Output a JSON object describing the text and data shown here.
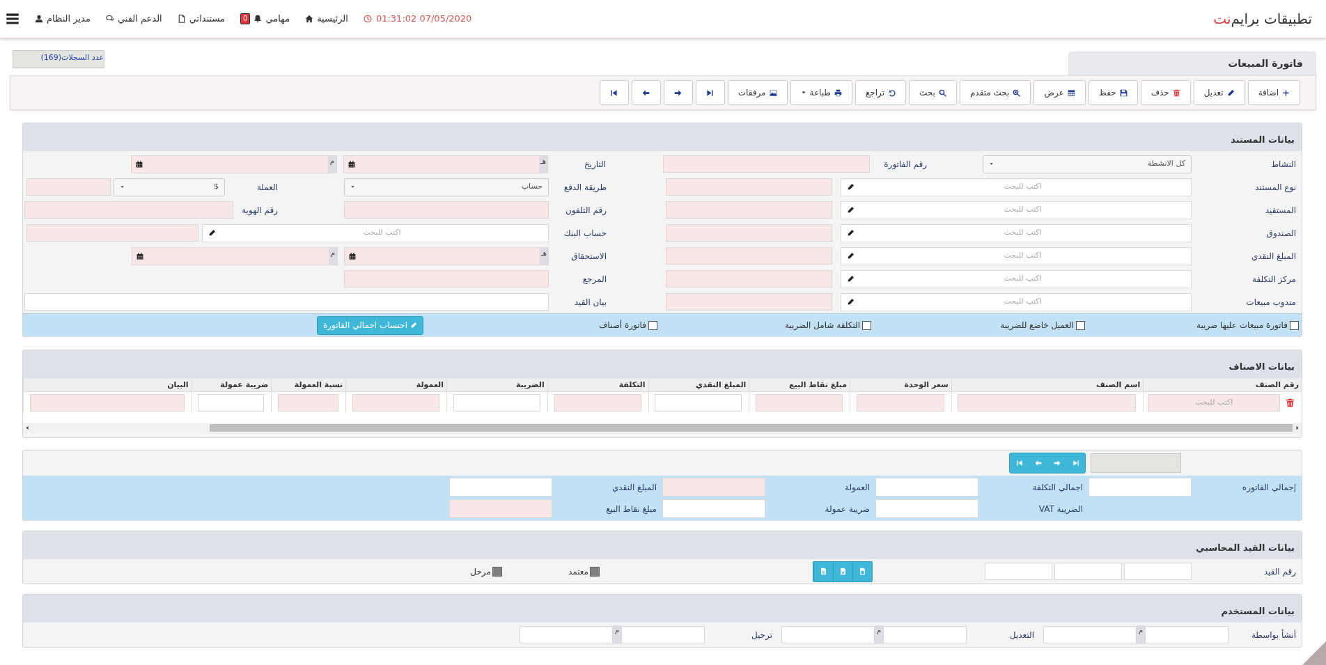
{
  "header": {
    "brand": "تطبيقات برايم",
    "brand_accent": "نت",
    "datetime": "01:31:02 07/05/2020",
    "nav": [
      {
        "kind": "home",
        "label": "الرئيسية"
      },
      {
        "kind": "tasks",
        "label": "مهامي",
        "badge": "0"
      },
      {
        "kind": "documents",
        "label": "مستنداتي"
      },
      {
        "kind": "support",
        "label": "الدعم الفني"
      },
      {
        "kind": "user",
        "label": "مدير النظام"
      }
    ]
  },
  "record_count": "عدد السجلات(169)",
  "page_title": "فاتورة المبيعات",
  "toolbar": [
    {
      "kind": "add",
      "label": "اضافة"
    },
    {
      "kind": "edit",
      "label": "تعديل"
    },
    {
      "kind": "delete",
      "label": "حذف"
    },
    {
      "kind": "save",
      "label": "حفظ"
    },
    {
      "kind": "view",
      "label": "عرض"
    },
    {
      "kind": "advanced_search",
      "label": "بحث متقدم"
    },
    {
      "kind": "search",
      "label": "بحث"
    },
    {
      "kind": "undo",
      "label": "تراجع"
    },
    {
      "kind": "print",
      "label": "طباعة"
    },
    {
      "kind": "attachments",
      "label": "مرفقات"
    },
    {
      "kind": "end_right"
    },
    {
      "kind": "arrow_right"
    },
    {
      "kind": "arrow_left"
    },
    {
      "kind": "end_left"
    }
  ],
  "document": {
    "title": "بيانات المستند",
    "rows": [
      {
        "fields": [
          {
            "label": "النشاط",
            "controls": [
              {
                "kind": "select",
                "value": "كل الانشطة"
              }
            ]
          },
          {
            "label": "رقم الفاتورة",
            "controls": [
              {
                "kind": "input",
                "required": true
              }
            ]
          },
          {
            "label": "التاريخ",
            "controls": [
              {
                "kind": "date",
                "suffix": "هـ",
                "required": true
              },
              {
                "kind": "date",
                "suffix": "م",
                "required": true
              }
            ]
          }
        ]
      },
      {
        "fields": [
          {
            "label": "نوع المستند",
            "controls": [
              {
                "kind": "search",
                "placeholder": "اكتب للبحث"
              },
              {
                "kind": "input",
                "required": true
              }
            ]
          },
          {
            "label": "طريقة الدفع",
            "controls": [
              {
                "kind": "select",
                "value": "حساب"
              }
            ]
          },
          {
            "label": "العملة",
            "controls": [
              {
                "kind": "select",
                "value": "$"
              },
              {
                "kind": "input",
                "required": true
              }
            ]
          }
        ]
      },
      {
        "fields": [
          {
            "label": "المستفيد",
            "controls": [
              {
                "kind": "search",
                "placeholder": "اكتب للبحث"
              },
              {
                "kind": "input",
                "required": true
              }
            ]
          },
          {
            "label": "رقم التلفون",
            "controls": [
              {
                "kind": "input",
                "required": true
              }
            ]
          },
          {
            "label": "رقم الهوية",
            "controls": [
              {
                "kind": "input",
                "required": true
              }
            ]
          }
        ]
      },
      {
        "fields": [
          {
            "label": "الصندوق",
            "controls": [
              {
                "kind": "search",
                "placeholder": "اكتب للبحث"
              },
              {
                "kind": "input",
                "required": true
              }
            ]
          },
          {
            "label": "حساب البنك",
            "controls": [
              {
                "kind": "search",
                "placeholder": "اكتب للبحث"
              },
              {
                "kind": "input",
                "required": true
              }
            ]
          }
        ]
      },
      {
        "fields": [
          {
            "label": "المبلغ النقدي",
            "controls": [
              {
                "kind": "search",
                "placeholder": "اكتب للبحث"
              },
              {
                "kind": "input",
                "required": true
              }
            ]
          },
          {
            "label": "الاستحقاق",
            "controls": [
              {
                "kind": "date",
                "suffix": "هـ",
                "required": true
              },
              {
                "kind": "date",
                "suffix": "م",
                "required": true
              }
            ]
          }
        ]
      },
      {
        "fields": [
          {
            "label": "مركز التكلفة",
            "controls": [
              {
                "kind": "search",
                "placeholder": "اكتب للبحث"
              },
              {
                "kind": "input",
                "required": true
              }
            ]
          },
          {
            "label": "المرجع",
            "controls": [
              {
                "kind": "input",
                "required": true
              }
            ]
          }
        ]
      },
      {
        "fields": [
          {
            "label": "مندوب مبيعات",
            "controls": [
              {
                "kind": "search",
                "placeholder": "اكتب للبحث"
              },
              {
                "kind": "input",
                "required": true
              }
            ]
          },
          {
            "label": "بيان القيد",
            "controls": [
              {
                "kind": "input",
                "required": false
              }
            ]
          }
        ]
      }
    ],
    "checks": [
      {
        "label": "فاتورة مبيعات عليها ضريبة",
        "checked": false
      },
      {
        "label": "العميل خاضع للضريبة",
        "checked": false
      },
      {
        "label": "التكلفة شامل الضريبة",
        "checked": false
      },
      {
        "label": "فاتورة أصناف",
        "checked": false
      }
    ],
    "calc_button": "احتساب اجمالي الفاتورة"
  },
  "items": {
    "title": "بيانات الاصناف",
    "columns": [
      "رقم الصنف",
      "اسم الصنف",
      "سعر الوحدة",
      "مبلغ نقاط البيع",
      "المبلغ النقدي",
      "التكلفة",
      "الضريبة",
      "العمولة",
      "نسبة العمولة",
      "ضريبة عمولة",
      "البيان"
    ],
    "row": [
      {
        "required": true,
        "placeholder": "اكتب للبحث"
      },
      {
        "required": true
      },
      {
        "required": true
      },
      {
        "required": true
      },
      {
        "required": false
      },
      {
        "required": true
      },
      {
        "required": false
      },
      {
        "required": true
      },
      {
        "required": true
      },
      {
        "required": false
      },
      {
        "required": true
      }
    ]
  },
  "totals": {
    "pager": [
      {
        "kind": "end_right"
      },
      {
        "kind": "arrow_right"
      },
      {
        "kind": "arrow_left"
      },
      {
        "kind": "end_left"
      }
    ],
    "rows": [
      {
        "fields": [
          {
            "label": "إجمالي الفاتوره",
            "required": false
          },
          {
            "label": "اجمالي التكلفة",
            "required": false
          },
          {
            "label": "العمولة",
            "required": true
          },
          {
            "label": "المبلغ النقدي",
            "required": false
          }
        ]
      },
      {
        "fields": [
          {
            "label": "الضريبة VAT",
            "required": false
          },
          {
            "label": "ضريبة عمولة",
            "required": false
          },
          {
            "label": "مبلغ نقاط البيع",
            "required": true
          }
        ]
      }
    ]
  },
  "accounting": {
    "title": "بيانات القيد المحاسبي",
    "label": "رقم القيد",
    "inputs": [
      {
        "required": false
      },
      {
        "required": false
      },
      {
        "required": false
      }
    ],
    "exports": [
      {
        "kind": "pdf"
      },
      {
        "kind": "word"
      },
      {
        "kind": "excel"
      }
    ],
    "flags": [
      {
        "label": "معتمد",
        "disabled": true
      },
      {
        "label": "مرحل",
        "disabled": true
      }
    ]
  },
  "user": {
    "title": "بيانات المستخدم",
    "fields": [
      {
        "label": "أنشأ بواسطة",
        "suffix": "م"
      },
      {
        "label": "التعديل",
        "suffix": "م"
      },
      {
        "label": "ترحيل",
        "suffix": "م"
      }
    ]
  }
}
